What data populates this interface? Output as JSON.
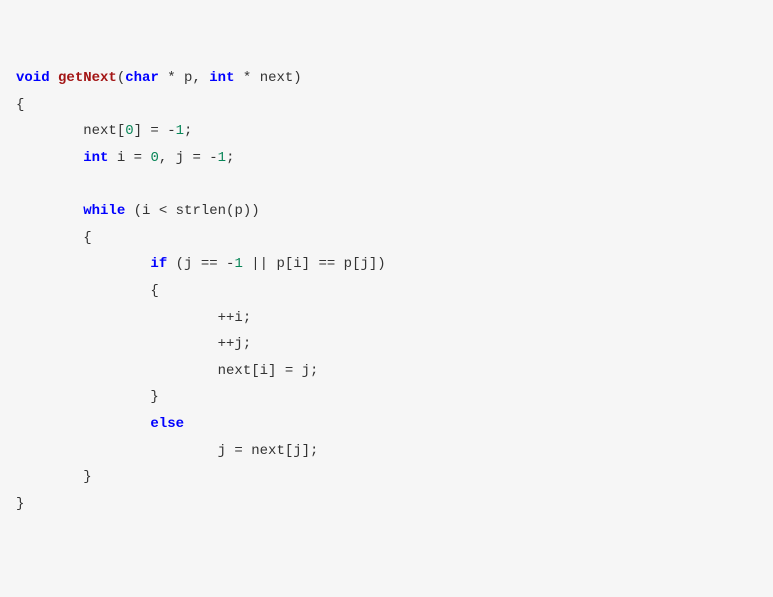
{
  "code": {
    "kw_void": "void",
    "fn_name": "getNext",
    "sig_open": "(",
    "kw_char": "char",
    "sig_p": " * p, ",
    "kw_int1": "int",
    "sig_next": " * next)",
    "brace_open": "{",
    "l1_a": "        next[",
    "l1_n0": "0",
    "l1_b": "] = -",
    "l1_n1": "1",
    "l1_c": ";",
    "l2_pad": "        ",
    "kw_int2": "int",
    "l2_a": " i = ",
    "l2_n0": "0",
    "l2_b": ", j = -",
    "l2_n1": "1",
    "l2_c": ";",
    "l3_pad": "        ",
    "kw_while": "while",
    "l3_a": " (i < strlen(p))",
    "l4": "        {",
    "l5_pad": "                ",
    "kw_if": "if",
    "l5_a": " (j == -",
    "l5_n1": "1",
    "l5_b": " || p[i] == p[j])",
    "l6": "                {",
    "l7": "                        ++i;",
    "l8": "                        ++j;",
    "l9": "                        next[i] = j;",
    "l10": "                }",
    "l11_pad": "                ",
    "kw_else": "else",
    "l12": "                        j = next[j];",
    "l13": "        }",
    "brace_close": "}"
  }
}
